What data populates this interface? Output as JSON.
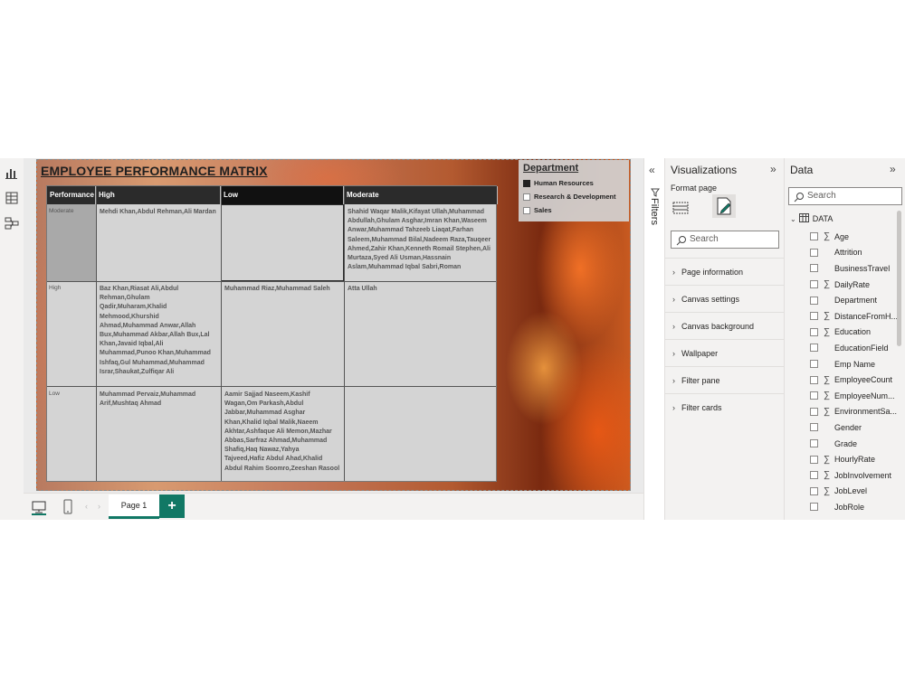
{
  "report": {
    "title": "EMPLOYEE PERFORMANCE MATRIX",
    "matrix": {
      "corner_header": "Performance",
      "column_headers": [
        "High",
        "Low",
        "Moderate"
      ],
      "rows": [
        {
          "label": "Moderate",
          "cells": [
            "Mehdi Khan,Abdul Rehman,Ali Mardan",
            "",
            "Shahid Waqar Malik,Kifayat Ullah,Muhammad Abdullah,Ghulam Asghar,Imran Khan,Waseem Anwar,Muhammad Tahzeeb Liaqat,Farhan Saleem,Muhammad Bilal,Nadeem Raza,Tauqeer Ahmed,Zahir Khan,Kenneth Romail Stephen,Ali Murtaza,Syed Ali Usman,Hassnain Aslam,Muhammad Iqbal Sabri,Roman"
          ]
        },
        {
          "label": "High",
          "cells": [
            "Baz Khan,Riasat Ali,Abdul Rehman,Ghulam Qadir,Muharam,Khalid Mehmood,Khurshid Ahmad,Muhammad Anwar,Allah Bux,Muhammad Akbar,Allah Bux,Lal Khan,Javaid Iqbal,Ali Muhammad,Punoo Khan,Muhammad Ishfaq,Gul Muhammad,Muhammad Israr,Shaukat,Zulfiqar Ali",
            "Muhammad Riaz,Muhammad Saleh",
            "Atta Ullah"
          ]
        },
        {
          "label": "Low",
          "cells": [
            "Muhammad Pervaiz,Muhammad Arif,Mushtaq Ahmad",
            "Aamir Sajjad Naseem,Kashif Wagan,Om Parkash,Abdul Jabbar,Muhammad Asghar Khan,Khalid Iqbal Malik,Naeem Akhtar,Ashfaque Ali Memon,Mazhar Abbas,Sarfraz Ahmad,Muhammad Shafiq,Haq Nawaz,Yahya Tajveed,Hafiz Abdul Ahad,Khalid Abdul Rahim Soomro,Zeeshan Rasool",
            ""
          ]
        }
      ]
    },
    "slicer": {
      "title": "Department",
      "items": [
        {
          "label": "Human Resources",
          "checked": true
        },
        {
          "label": "Research & Development",
          "checked": false
        },
        {
          "label": "Sales",
          "checked": false
        }
      ]
    }
  },
  "tabs": {
    "page_label": "Page 1",
    "add_label": "+"
  },
  "filters": {
    "label": "Filters"
  },
  "visualizations": {
    "title": "Visualizations",
    "format_label": "Format page",
    "search_placeholder": "Search",
    "sections": [
      "Page information",
      "Canvas settings",
      "Canvas background",
      "Wallpaper",
      "Filter pane",
      "Filter cards"
    ]
  },
  "data_pane": {
    "title": "Data",
    "search_placeholder": "Search",
    "table_name": "DATA",
    "fields": [
      {
        "name": "Age",
        "sigma": true
      },
      {
        "name": "Attrition",
        "sigma": false
      },
      {
        "name": "BusinessTravel",
        "sigma": false
      },
      {
        "name": "DailyRate",
        "sigma": true
      },
      {
        "name": "Department",
        "sigma": false
      },
      {
        "name": "DistanceFromH...",
        "sigma": true
      },
      {
        "name": "Education",
        "sigma": true
      },
      {
        "name": "EducationField",
        "sigma": false
      },
      {
        "name": "Emp Name",
        "sigma": false
      },
      {
        "name": "EmployeeCount",
        "sigma": true
      },
      {
        "name": "EmployeeNum...",
        "sigma": true
      },
      {
        "name": "EnvironmentSa...",
        "sigma": true
      },
      {
        "name": "Gender",
        "sigma": false
      },
      {
        "name": "Grade",
        "sigma": false
      },
      {
        "name": "HourlyRate",
        "sigma": true
      },
      {
        "name": "JobInvolvement",
        "sigma": true
      },
      {
        "name": "JobLevel",
        "sigma": true
      },
      {
        "name": "JobRole",
        "sigma": false
      }
    ]
  },
  "colors": {
    "accent": "#117865",
    "header_dark": "#2b2b2b",
    "matrix_bg": "#d4d4d4"
  }
}
